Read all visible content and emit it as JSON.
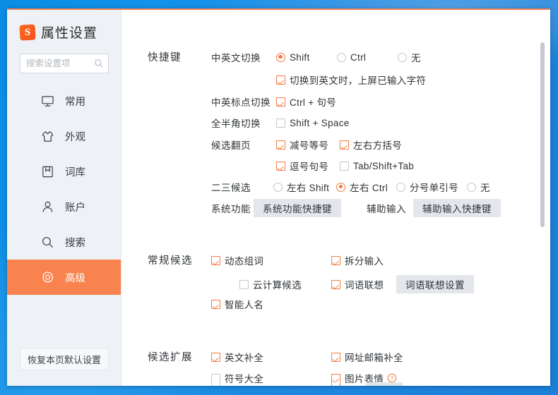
{
  "app": {
    "brand_title": "属性设置",
    "logo_letter": "S",
    "accent_orange": "#f8834f",
    "check_orange": "#f4793f",
    "desktop_blue": "#1292ea"
  },
  "titlebar": {
    "help_label": "?",
    "minimize_label": "–",
    "close_label": "✕"
  },
  "search": {
    "placeholder": "搜索设置项",
    "value": "",
    "icon": "search-icon"
  },
  "sidebar": {
    "items": [
      {
        "label": "常用",
        "icon": "monitor-icon",
        "active": false
      },
      {
        "label": "外观",
        "icon": "shirt-icon",
        "active": false
      },
      {
        "label": "词库",
        "icon": "book-icon",
        "active": false
      },
      {
        "label": "账户",
        "icon": "user-icon",
        "active": false
      },
      {
        "label": "搜索",
        "icon": "search-icon",
        "active": false
      },
      {
        "label": "高级",
        "icon": "gear-icon",
        "active": true
      }
    ],
    "reset_label": "恢复本页默认设置"
  },
  "groups": {
    "hotkey": {
      "title": "快捷键",
      "cn_en_switch_label": "中英文切换",
      "cn_en_options": [
        {
          "label": "Shift",
          "selected": true
        },
        {
          "label": "Ctrl",
          "selected": false
        },
        {
          "label": "无",
          "selected": false
        }
      ],
      "commit_on_switch": {
        "label": "切换到英文时，上屏已输入字符",
        "checked": true
      },
      "punct_switch_label": "中英标点切换",
      "punct_switch": {
        "label": "Ctrl + 句号",
        "checked": true
      },
      "width_switch_label": "全半角切换",
      "width_switch": {
        "label": "Shift + Space",
        "checked": false
      },
      "page_turn_label": "候选翻页",
      "page_turn": [
        {
          "label": "减号等号",
          "checked": true
        },
        {
          "label": "左右方括号",
          "checked": true
        },
        {
          "label": "逗号句号",
          "checked": true
        },
        {
          "label": "Tab/Shift+Tab",
          "checked": false
        }
      ],
      "second_third_label": "二三候选",
      "second_third": [
        {
          "label": "左右 Shift",
          "selected": false
        },
        {
          "label": "左右 Ctrl",
          "selected": true
        },
        {
          "label": "分号单引号",
          "selected": false
        },
        {
          "label": "无",
          "selected": false
        }
      ],
      "system_func_label": "系统功能",
      "system_func_button": "系统功能快捷键",
      "assist_input_label": "辅助输入",
      "assist_input_button": "辅助输入快捷键"
    },
    "normal_candidate": {
      "title": "常规候选",
      "items": [
        {
          "label": "动态组词",
          "checked": true
        },
        {
          "label": "拆分输入",
          "checked": true
        },
        {
          "label": "云计算候选",
          "checked": false
        },
        {
          "label": "词语联想",
          "checked": true
        },
        {
          "label": "智能人名",
          "checked": true
        }
      ],
      "assoc_button": "词语联想设置"
    },
    "candidate_ext": {
      "title": "候选扩展",
      "items": [
        {
          "label": "英文补全",
          "checked": true
        },
        {
          "label": "网址邮箱补全",
          "checked": true
        },
        {
          "label": "符号大全",
          "checked": false
        },
        {
          "label": "图片表情",
          "checked": true,
          "help": true
        }
      ]
    }
  }
}
